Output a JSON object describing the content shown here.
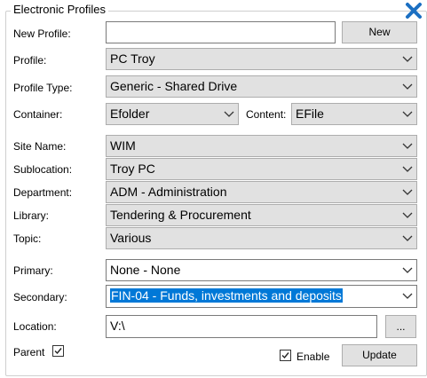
{
  "title": "Electronic Profiles",
  "new_profile": {
    "label": "New Profile:",
    "value": "",
    "button": "New"
  },
  "profile": {
    "label": "Profile:",
    "value": "PC Troy"
  },
  "profile_type": {
    "label": "Profile Type:",
    "value": "Generic - Shared Drive"
  },
  "container": {
    "label": "Container:",
    "value": "Efolder"
  },
  "content": {
    "label": "Content:",
    "value": "EFile"
  },
  "site_name": {
    "label": "Site Name:",
    "value": "WIM"
  },
  "sublocation": {
    "label": "Sublocation:",
    "value": "Troy PC"
  },
  "department": {
    "label": "Department:",
    "value": "ADM - Administration"
  },
  "library": {
    "label": "Library:",
    "value": "Tendering & Procurement"
  },
  "topic": {
    "label": "Topic:",
    "value": "Various"
  },
  "primary": {
    "label": "Primary:",
    "value": "None - None"
  },
  "secondary": {
    "label": "Secondary:",
    "value": "FIN-04 - Funds, investments and deposits"
  },
  "location": {
    "label": "Location:",
    "value": "V:\\",
    "browse": "..."
  },
  "parent": {
    "label": "Parent",
    "checked": true
  },
  "enable": {
    "label": "Enable",
    "checked": true
  },
  "update_button": "Update",
  "icons": {
    "close": "close-icon",
    "dropdown": "chevron-down-icon",
    "check": "checkmark-icon"
  },
  "colors": {
    "close_icon": "#1b6fc2",
    "selection": "#0078d7"
  }
}
